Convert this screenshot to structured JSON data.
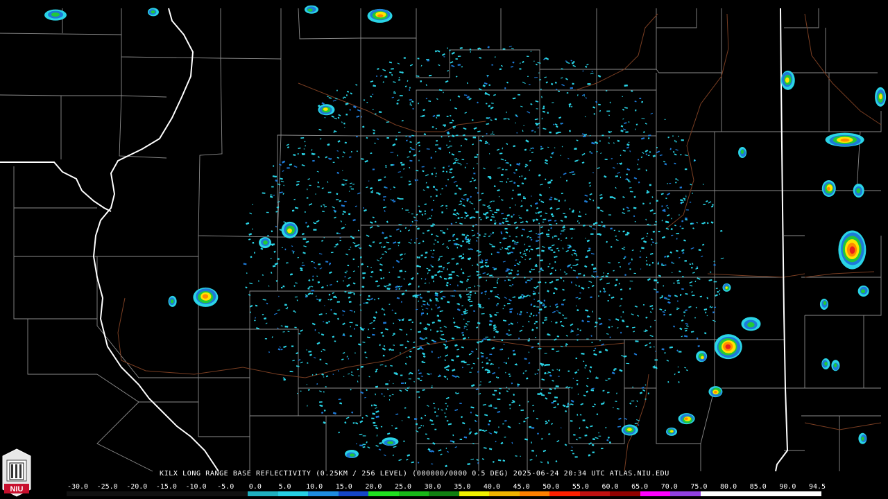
{
  "caption": "KILX LONG RANGE BASE REFLECTIVITY (0.25KM / 256 LEVEL) (000000/0000 0.5 DEG) 2025-06-24 20:34 UTC  ATLAS.NIU.EDU",
  "logo_text": "NIU",
  "colors": {
    "background": "#000000",
    "county_lines": "#9a9a9a",
    "state_lines": "#ffffff",
    "rivers": "#8a4a2a",
    "echo_light": "#2ad4e6",
    "echo_blue": "#1e7ad8",
    "echo_green": "#22c83a",
    "echo_yellow": "#ffe400",
    "echo_orange": "#ff8a00",
    "echo_red": "#e8201a"
  },
  "scale": {
    "labels": [
      "-30.0",
      "-25.0",
      "-20.0",
      "-15.0",
      "-10.0",
      "-5.0",
      "0.0",
      "5.0",
      "10.0",
      "15.0",
      "20.0",
      "25.0",
      "30.0",
      "35.0",
      "40.0",
      "45.0",
      "50.0",
      "55.0",
      "60.0",
      "65.0",
      "70.0",
      "75.0",
      "80.0",
      "85.0",
      "90.0",
      "94.5"
    ],
    "bar_colors": [
      "#000000",
      "#000000",
      "#000000",
      "#000000",
      "#000000",
      "#000000",
      "#20b0c0",
      "#26d0e6",
      "#1e8ce0",
      "#1446c8",
      "#20e020",
      "#18b818",
      "#108010",
      "#f0f000",
      "#f0b400",
      "#ff8000",
      "#ff2000",
      "#c01010",
      "#900000",
      "#ff00ff",
      "#9040e0",
      "#ffffff",
      "#ffffff",
      "#ffffff",
      "#ffffff"
    ]
  }
}
